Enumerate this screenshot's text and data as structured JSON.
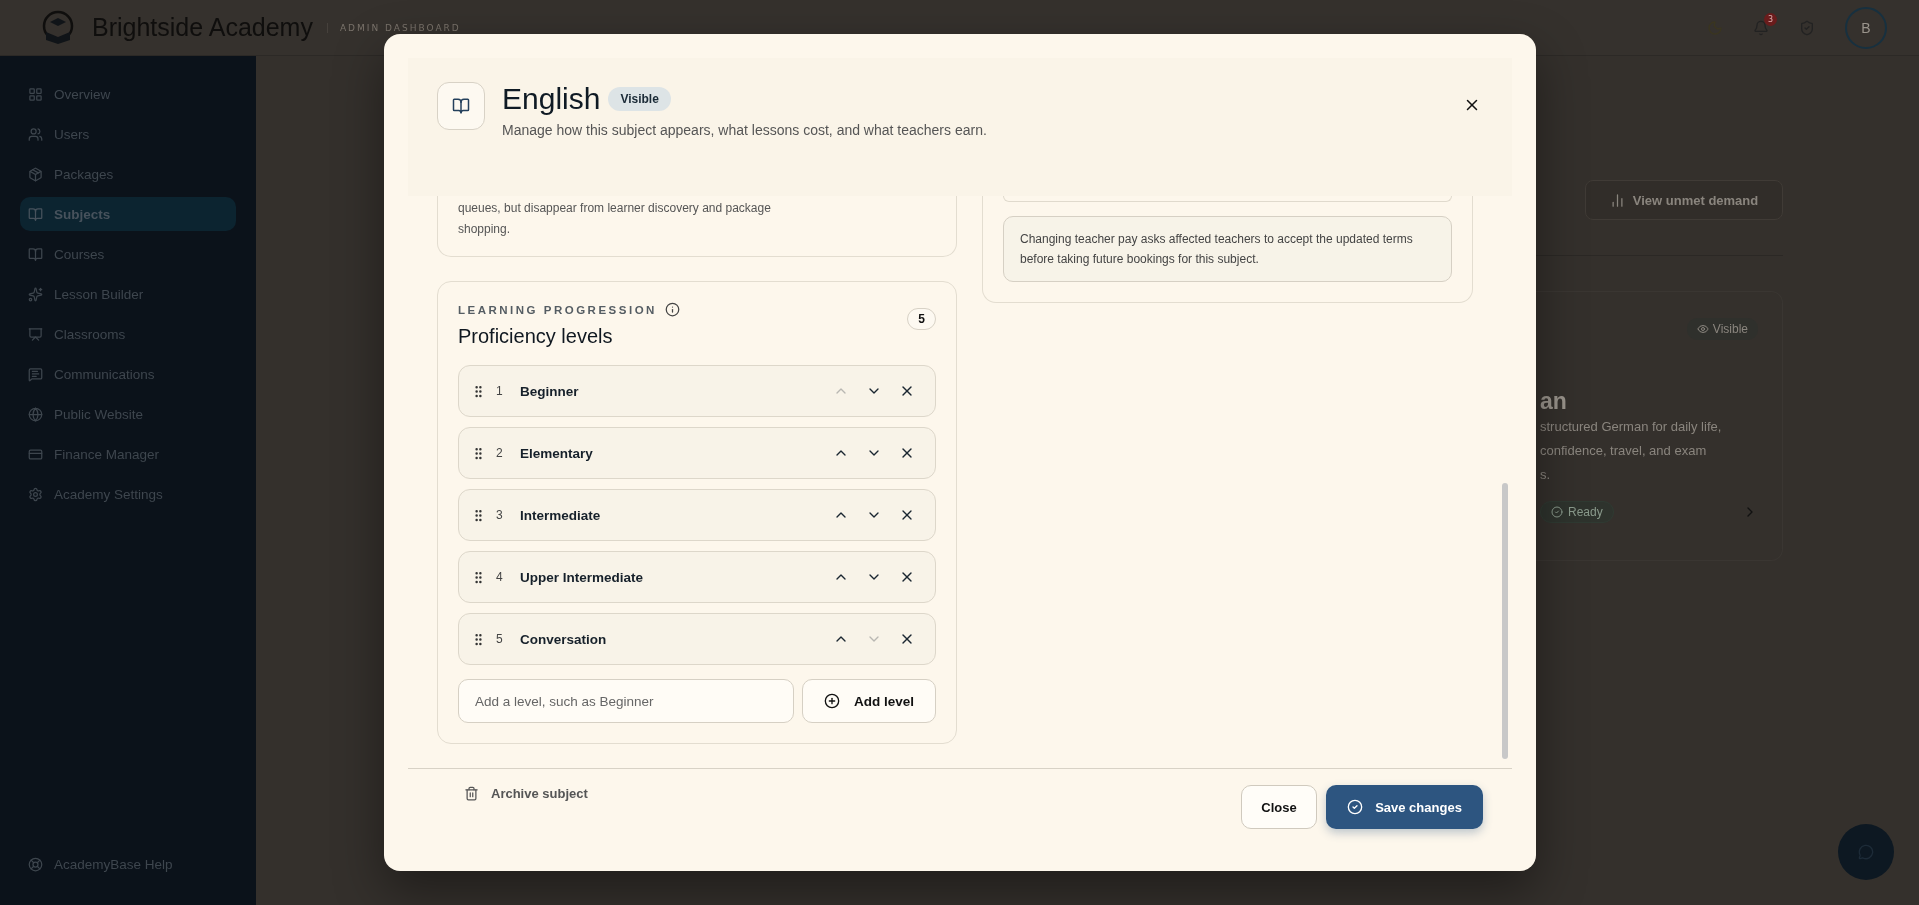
{
  "topbar": {
    "brand": "Brightside Academy",
    "tagline": "ADMIN DASHBOARD",
    "notification_count": "3",
    "avatar_initial": "B"
  },
  "sidebar": {
    "items": [
      {
        "label": "Overview",
        "selected": false
      },
      {
        "label": "Users",
        "selected": false
      },
      {
        "label": "Packages",
        "selected": false
      },
      {
        "label": "Subjects",
        "selected": true
      },
      {
        "label": "Courses",
        "selected": false
      },
      {
        "label": "Lesson Builder",
        "selected": false
      },
      {
        "label": "Classrooms",
        "selected": false
      },
      {
        "label": "Communications",
        "selected": false
      },
      {
        "label": "Public Website",
        "selected": false
      },
      {
        "label": "Finance Manager",
        "selected": false
      },
      {
        "label": "Academy Settings",
        "selected": false
      }
    ],
    "help": "AcademyBase Help"
  },
  "background": {
    "demand_button": "View unmet demand",
    "card": {
      "badge": "Visible",
      "title": "an",
      "lines": [
        "structured German for daily life,",
        "confidence, travel, and exam",
        "s."
      ],
      "status": "Ready"
    }
  },
  "modal": {
    "title": "English",
    "status": "Visible",
    "subtitle": "Manage how this subject appears, what lessons cost, and what teachers earn.",
    "visibility_note": "queues, but disappear from learner discovery and package shopping.",
    "pay_note": "Changing teacher pay asks affected teachers to accept the updated terms before taking future bookings for this subject.",
    "progression": {
      "eyebrow": "LEARNING PROGRESSION",
      "title": "Proficiency levels",
      "count": "5",
      "levels": [
        {
          "number": "1",
          "name": "Beginner",
          "can_move_up": false,
          "can_move_down": true
        },
        {
          "number": "2",
          "name": "Elementary",
          "can_move_up": true,
          "can_move_down": true
        },
        {
          "number": "3",
          "name": "Intermediate",
          "can_move_up": true,
          "can_move_down": true
        },
        {
          "number": "4",
          "name": "Upper Intermediate",
          "can_move_up": true,
          "can_move_down": true
        },
        {
          "number": "5",
          "name": "Conversation",
          "can_move_up": true,
          "can_move_down": false
        }
      ],
      "placeholder": "Add a level, such as Beginner",
      "add_button": "Add level"
    },
    "footer": {
      "archive": "Archive subject",
      "close": "Close",
      "save": "Save changes"
    }
  }
}
